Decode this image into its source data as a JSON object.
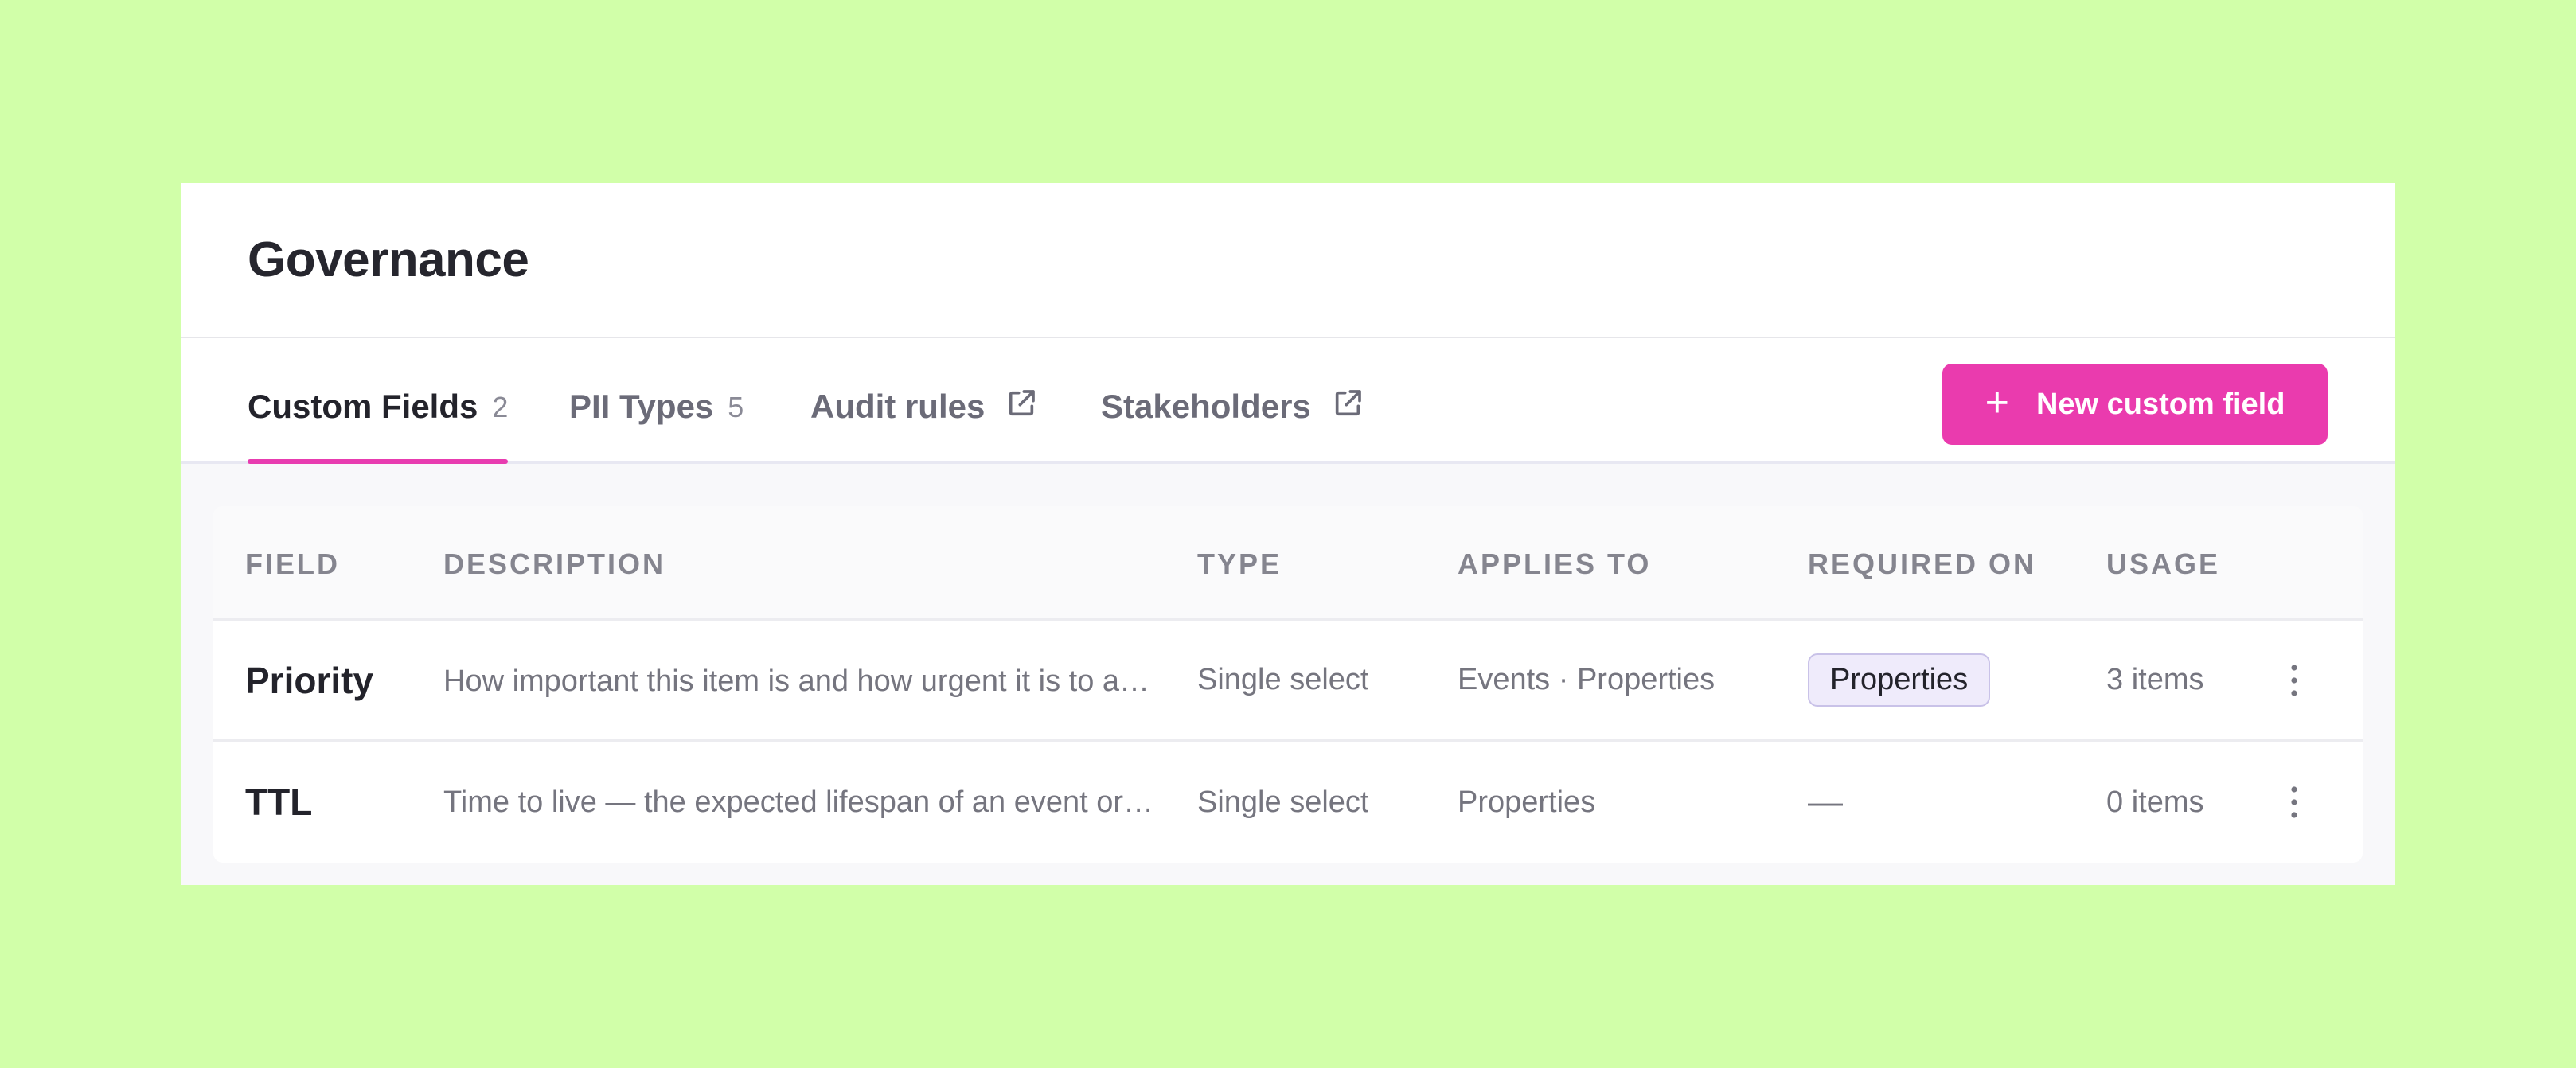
{
  "page": {
    "title": "Governance"
  },
  "tabs": [
    {
      "label": "Custom Fields",
      "count": "2",
      "active": true
    },
    {
      "label": "PII Types",
      "count": "5",
      "active": false
    },
    {
      "label": "Audit rules",
      "icon": "external-link-icon",
      "active": false
    },
    {
      "label": "Stakeholders",
      "icon": "external-link-icon",
      "active": false
    }
  ],
  "actions": {
    "new_button": {
      "label": "New custom field",
      "icon": "plus-icon"
    }
  },
  "table": {
    "columns": [
      "FIELD",
      "DESCRIPTION",
      "TYPE",
      "APPLIES TO",
      "REQUIRED ON",
      "USAGE"
    ],
    "rows": [
      {
        "field": "Priority",
        "description": "How important this item is and how urgent it is to address",
        "type": "Single select",
        "applies_to": "Events · Properties",
        "required_on": "Properties",
        "usage": "3 items"
      },
      {
        "field": "TTL",
        "description": "Time to live — the expected lifespan of an event or property",
        "type": "Single select",
        "applies_to": "Properties",
        "required_on": "—",
        "usage": "0 items"
      }
    ]
  },
  "colors": {
    "accent": "#ea3bae",
    "background": "#d1ffa9",
    "badge_bg": "#efebfb",
    "badge_border": "#c9c2e8"
  }
}
